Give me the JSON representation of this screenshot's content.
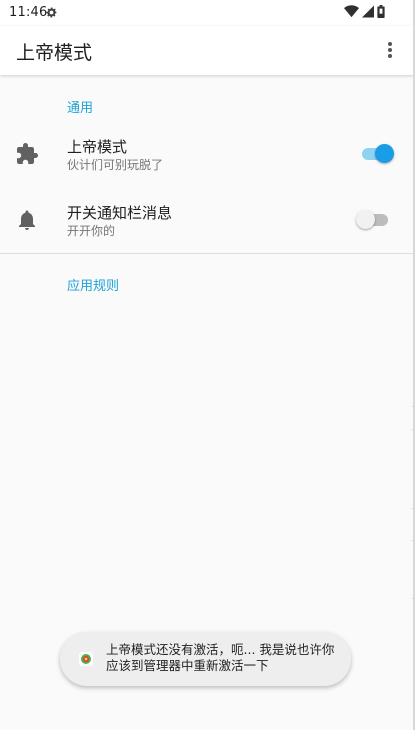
{
  "status_bar": {
    "time": "11:46",
    "icons": [
      "settings-icon",
      "wifi-icon",
      "signal-icon",
      "battery-icon"
    ]
  },
  "app_bar": {
    "title": "上帝模式",
    "overflow_icon": "more-vert-icon"
  },
  "sections": [
    {
      "header": "通用",
      "items": [
        {
          "icon": "extension-icon",
          "title": "上帝模式",
          "summary": "伙计们可别玩脱了",
          "switch_on": true
        },
        {
          "icon": "bell-icon",
          "title": "开关通知栏消息",
          "summary": "开开你的",
          "switch_on": false
        }
      ]
    },
    {
      "header": "应用规则",
      "items": []
    }
  ],
  "toast": {
    "text": "上帝模式还没有激活，呃... 我是说也许你应该到管理器中重新激活一下",
    "icon": "app-icon"
  },
  "colors": {
    "accent": "#1aa3d6",
    "switch_on_thumb": "#1a9de8",
    "switch_on_track": "#8fd3f2",
    "background": "#fafafa"
  }
}
